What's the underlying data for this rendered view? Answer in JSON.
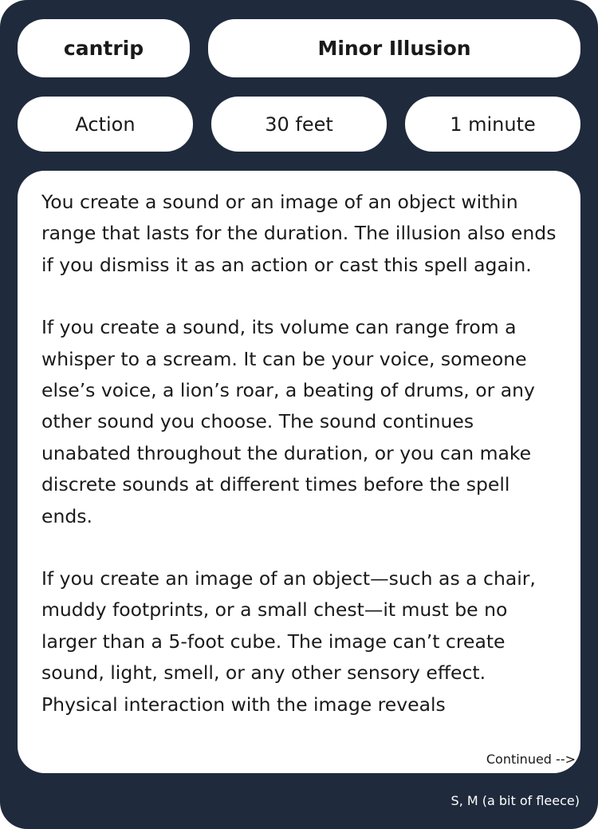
{
  "spell": {
    "level": "cantrip",
    "name": "Minor Illusion",
    "casting_time": "Action",
    "range": "30 feet",
    "duration": "1 minute",
    "description": [
      "You create a sound or an image of an object within range that lasts for the duration. The illusion also ends if you dismiss it as an action or cast this spell again.",
      "If you create a sound, its volume can range from a whisper to a scream. It can be your voice, someone else’s voice, a lion’s roar, a beating of drums, or any other sound you choose. The sound continues unabated throughout the duration, or you can make discrete sounds at different times before the spell ends.",
      "If you create an image of an object—such as a chair, muddy footprints, or a small chest—it must be no larger than a 5-foot cube. The image can’t create sound, light, smell, or any other sensory effect. Physical interaction with the image reveals"
    ],
    "continued_label": "Continued -->",
    "components": "S, M (a bit of fleece)"
  },
  "colors": {
    "card_background": "#1f2a3c",
    "panel_background": "#ffffff",
    "text": "#1a1a1a"
  }
}
